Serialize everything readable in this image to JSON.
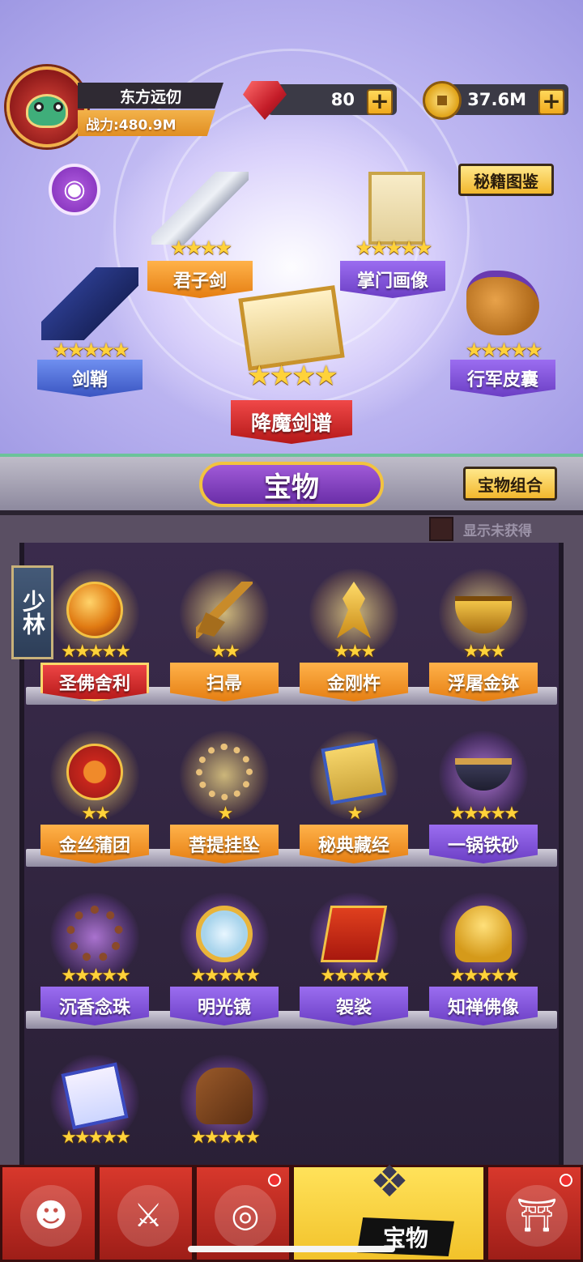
{
  "player": {
    "name": "东方远仞",
    "power": "战力:480.9M"
  },
  "currency": {
    "gems": "80",
    "coins": "37.6M",
    "plus": "+"
  },
  "buttons": {
    "secret_catalog": "秘籍图鉴",
    "treasure_combo": "宝物组合",
    "show_unobtained": "显示未获得"
  },
  "section_title": "宝物",
  "sect_tag": "少林",
  "equipped": [
    {
      "name": "君子剑",
      "stars": "★★★★",
      "icon": "sword-icon"
    },
    {
      "name": "掌门画像",
      "stars": "★★★★★",
      "icon": "portrait-scroll-icon"
    },
    {
      "name": "剑鞘",
      "stars": "★★★★★",
      "icon": "sheath-icon"
    },
    {
      "name": "降魔剑谱",
      "stars": "★★★★",
      "icon": "sword-manual-icon"
    },
    {
      "name": "行军皮囊",
      "stars": "★★★★★",
      "icon": "pouch-icon"
    }
  ],
  "collection": [
    {
      "name": "圣佛舍利",
      "stars": "★★★★★",
      "icon": "relic-orb-icon",
      "selected": true
    },
    {
      "name": "扫帚",
      "stars": "★★",
      "icon": "broom-icon"
    },
    {
      "name": "金刚杵",
      "stars": "★★★",
      "icon": "vajra-icon"
    },
    {
      "name": "浮屠金钵",
      "stars": "★★★",
      "icon": "golden-bowl-icon"
    },
    {
      "name": "金丝蒲团",
      "stars": "★★",
      "icon": "cushion-icon"
    },
    {
      "name": "菩提挂坠",
      "stars": "★",
      "icon": "bodhi-pendant-icon"
    },
    {
      "name": "秘典藏经",
      "stars": "★",
      "icon": "scripture-icon"
    },
    {
      "name": "一锅铁砂",
      "stars": "★★★★★",
      "icon": "iron-sand-wok-icon"
    },
    {
      "name": "沉香念珠",
      "stars": "★★★★★",
      "icon": "prayer-beads-icon"
    },
    {
      "name": "明光镜",
      "stars": "★★★★★",
      "icon": "mirror-icon"
    },
    {
      "name": "袈裟",
      "stars": "★★★★★",
      "icon": "kasaya-icon"
    },
    {
      "name": "知禅佛像",
      "stars": "★★★★★",
      "icon": "buddha-statue-icon"
    },
    {
      "name": "",
      "stars": "★★★★★",
      "icon": "scroll-icon"
    },
    {
      "name": "",
      "stars": "★★★★★",
      "icon": "mallet-icon"
    }
  ],
  "nav": {
    "active_label": "宝物",
    "tabs": [
      "hero-icon",
      "weapon-icon",
      "drum-icon",
      "treasure-icon",
      "gate-icon"
    ]
  }
}
